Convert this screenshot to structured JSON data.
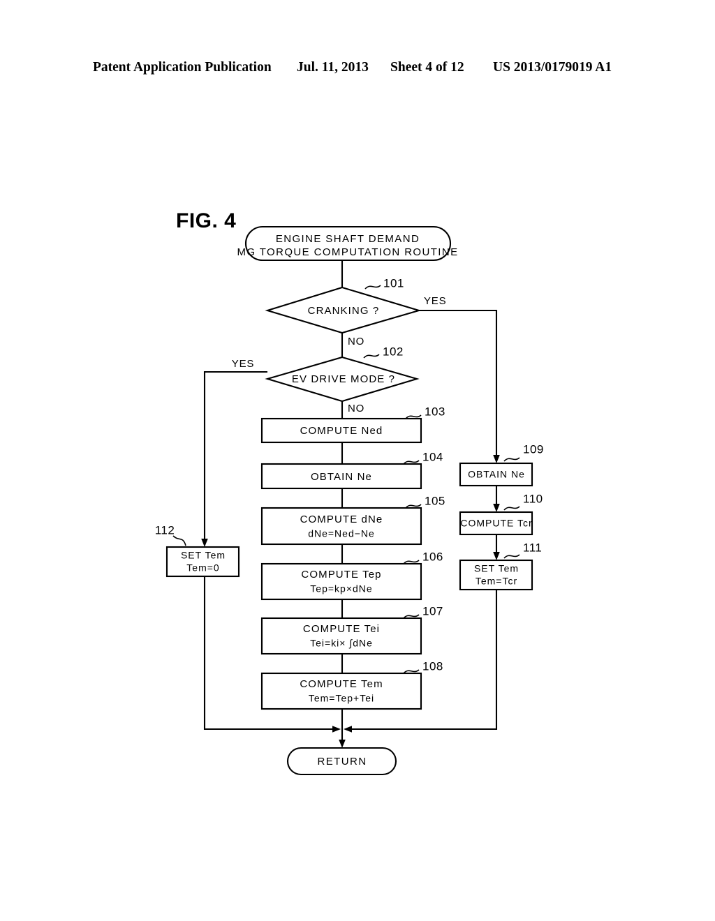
{
  "header": {
    "publication": "Patent Application Publication",
    "date": "Jul. 11, 2013",
    "sheet": "Sheet 4 of 12",
    "number": "US 2013/0179019 A1"
  },
  "figure": {
    "label": "FIG. 4"
  },
  "flowchart": {
    "start": {
      "ref": "",
      "line1": "ENGINE SHAFT DEMAND",
      "line2": "MG TORQUE COMPUTATION ROUTINE"
    },
    "end": {
      "label": "RETURN"
    },
    "steps": [
      {
        "ref": "101",
        "type": "decision",
        "line1": "CRANKING ?",
        "line2": "",
        "yes_label": "YES",
        "no_label": "NO"
      },
      {
        "ref": "102",
        "type": "decision",
        "line1": "EV DRIVE MODE ?",
        "line2": "",
        "yes_label": "YES",
        "no_label": "NO"
      },
      {
        "ref": "103",
        "type": "process",
        "line1": "COMPUTE Ned",
        "line2": ""
      },
      {
        "ref": "104",
        "type": "process",
        "line1": "OBTAIN Ne",
        "line2": ""
      },
      {
        "ref": "105",
        "type": "process",
        "line1": "COMPUTE dNe",
        "line2": "dNe=Ned−Ne"
      },
      {
        "ref": "106",
        "type": "process",
        "line1": "COMPUTE Tep",
        "line2": "Tep=kp×dNe"
      },
      {
        "ref": "107",
        "type": "process",
        "line1": "COMPUTE Tei",
        "line2": "Tei=ki× ∫dNe"
      },
      {
        "ref": "108",
        "type": "process",
        "line1": "COMPUTE Tem",
        "line2": "Tem=Tep+Tei"
      },
      {
        "ref": "109",
        "type": "process",
        "line1": "OBTAIN Ne",
        "line2": ""
      },
      {
        "ref": "110",
        "type": "process",
        "line1": "COMPUTE Tcr",
        "line2": ""
      },
      {
        "ref": "111",
        "type": "process",
        "line1": "SET Tem",
        "line2": "Tem=Tcr"
      },
      {
        "ref": "112",
        "type": "process",
        "line1": "SET Tem",
        "line2": "Tem=0"
      }
    ]
  },
  "colors": {
    "ink": "#000000",
    "paper": "#ffffff"
  }
}
